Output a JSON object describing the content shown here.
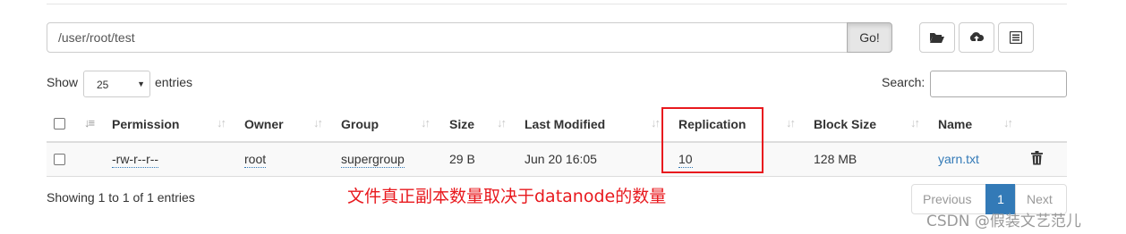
{
  "path_bar": {
    "value": "/user/root/test",
    "go_label": "Go!",
    "tools": [
      {
        "icon": "folder-open-icon"
      },
      {
        "icon": "cloud-upload-icon"
      },
      {
        "icon": "list-alt-icon"
      }
    ]
  },
  "controls": {
    "show_label": "Show",
    "entries_value": "25",
    "entries_label": "entries",
    "search_label": "Search:",
    "search_value": ""
  },
  "table": {
    "headers": [
      "Permission",
      "Owner",
      "Group",
      "Size",
      "Last Modified",
      "Replication",
      "Block Size",
      "Name"
    ],
    "rows": [
      {
        "permission": "-rw-r--r--",
        "owner": "root",
        "group": "supergroup",
        "size": "29 B",
        "last_modified": "Jun 20 16:05",
        "replication": "10",
        "block_size": "128 MB",
        "name": "yarn.txt"
      }
    ]
  },
  "footer": {
    "info": "Showing 1 to 1 of 1 entries",
    "previous": "Previous",
    "current_page": "1",
    "next": "Next"
  },
  "annotation": {
    "text": "文件真正副本数量取决于datanode的数量",
    "color": "#e8191e"
  },
  "watermark": "CSDN @假装文艺范儿",
  "colors": {
    "accent": "#337ab7",
    "highlight": "#e8191e"
  }
}
